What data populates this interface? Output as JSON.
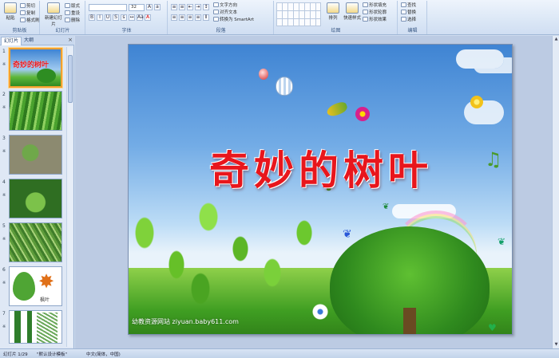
{
  "ribbon": {
    "clipboard": {
      "paste": "粘贴",
      "cut": "剪切",
      "copy": "复制",
      "format_painter": "格式刷",
      "group": "剪贴板"
    },
    "slides": {
      "new_slide": "新建幻灯片",
      "layout": "版式",
      "reset": "重设",
      "delete": "删除",
      "group": "幻灯片"
    },
    "font": {
      "font_name": "",
      "font_size": "32",
      "group": "字体"
    },
    "paragraph": {
      "text_direction": "文字方向",
      "align_text": "对齐文本",
      "smartart": "转换为 SmartArt",
      "group": "段落"
    },
    "drawing": {
      "arrange": "排列",
      "quick_styles": "快速样式",
      "fill": "形状填充",
      "outline": "形状轮廓",
      "effects": "形状效果",
      "group": "绘图"
    },
    "editing": {
      "find": "查找",
      "replace": "替换",
      "select": "选择",
      "group": "编辑"
    }
  },
  "left_pane": {
    "tab_slides": "幻灯片",
    "tab_outline": "大纲",
    "close": "×",
    "thumbnails": [
      {
        "num": "1",
        "star": "※",
        "caption": "奇妙的树叶"
      },
      {
        "num": "2",
        "star": "※"
      },
      {
        "num": "3",
        "star": "※"
      },
      {
        "num": "4",
        "star": "※"
      },
      {
        "num": "5",
        "star": "※"
      },
      {
        "num": "6",
        "star": "※",
        "caption": "枫叶"
      },
      {
        "num": "7",
        "star": "※"
      }
    ]
  },
  "slide": {
    "title": "奇妙的树叶",
    "watermark": "幼教资源网站  ziyuan.baby611.com"
  },
  "status": {
    "slide_info": "幻灯片 1/29",
    "theme": "\"默认设计模板\"",
    "language": "中文(简体，中国)"
  },
  "colors": {
    "title_red": "#e8161c",
    "accent_orange": "#f0a030",
    "ribbon_bg": "#dbe7f6"
  }
}
